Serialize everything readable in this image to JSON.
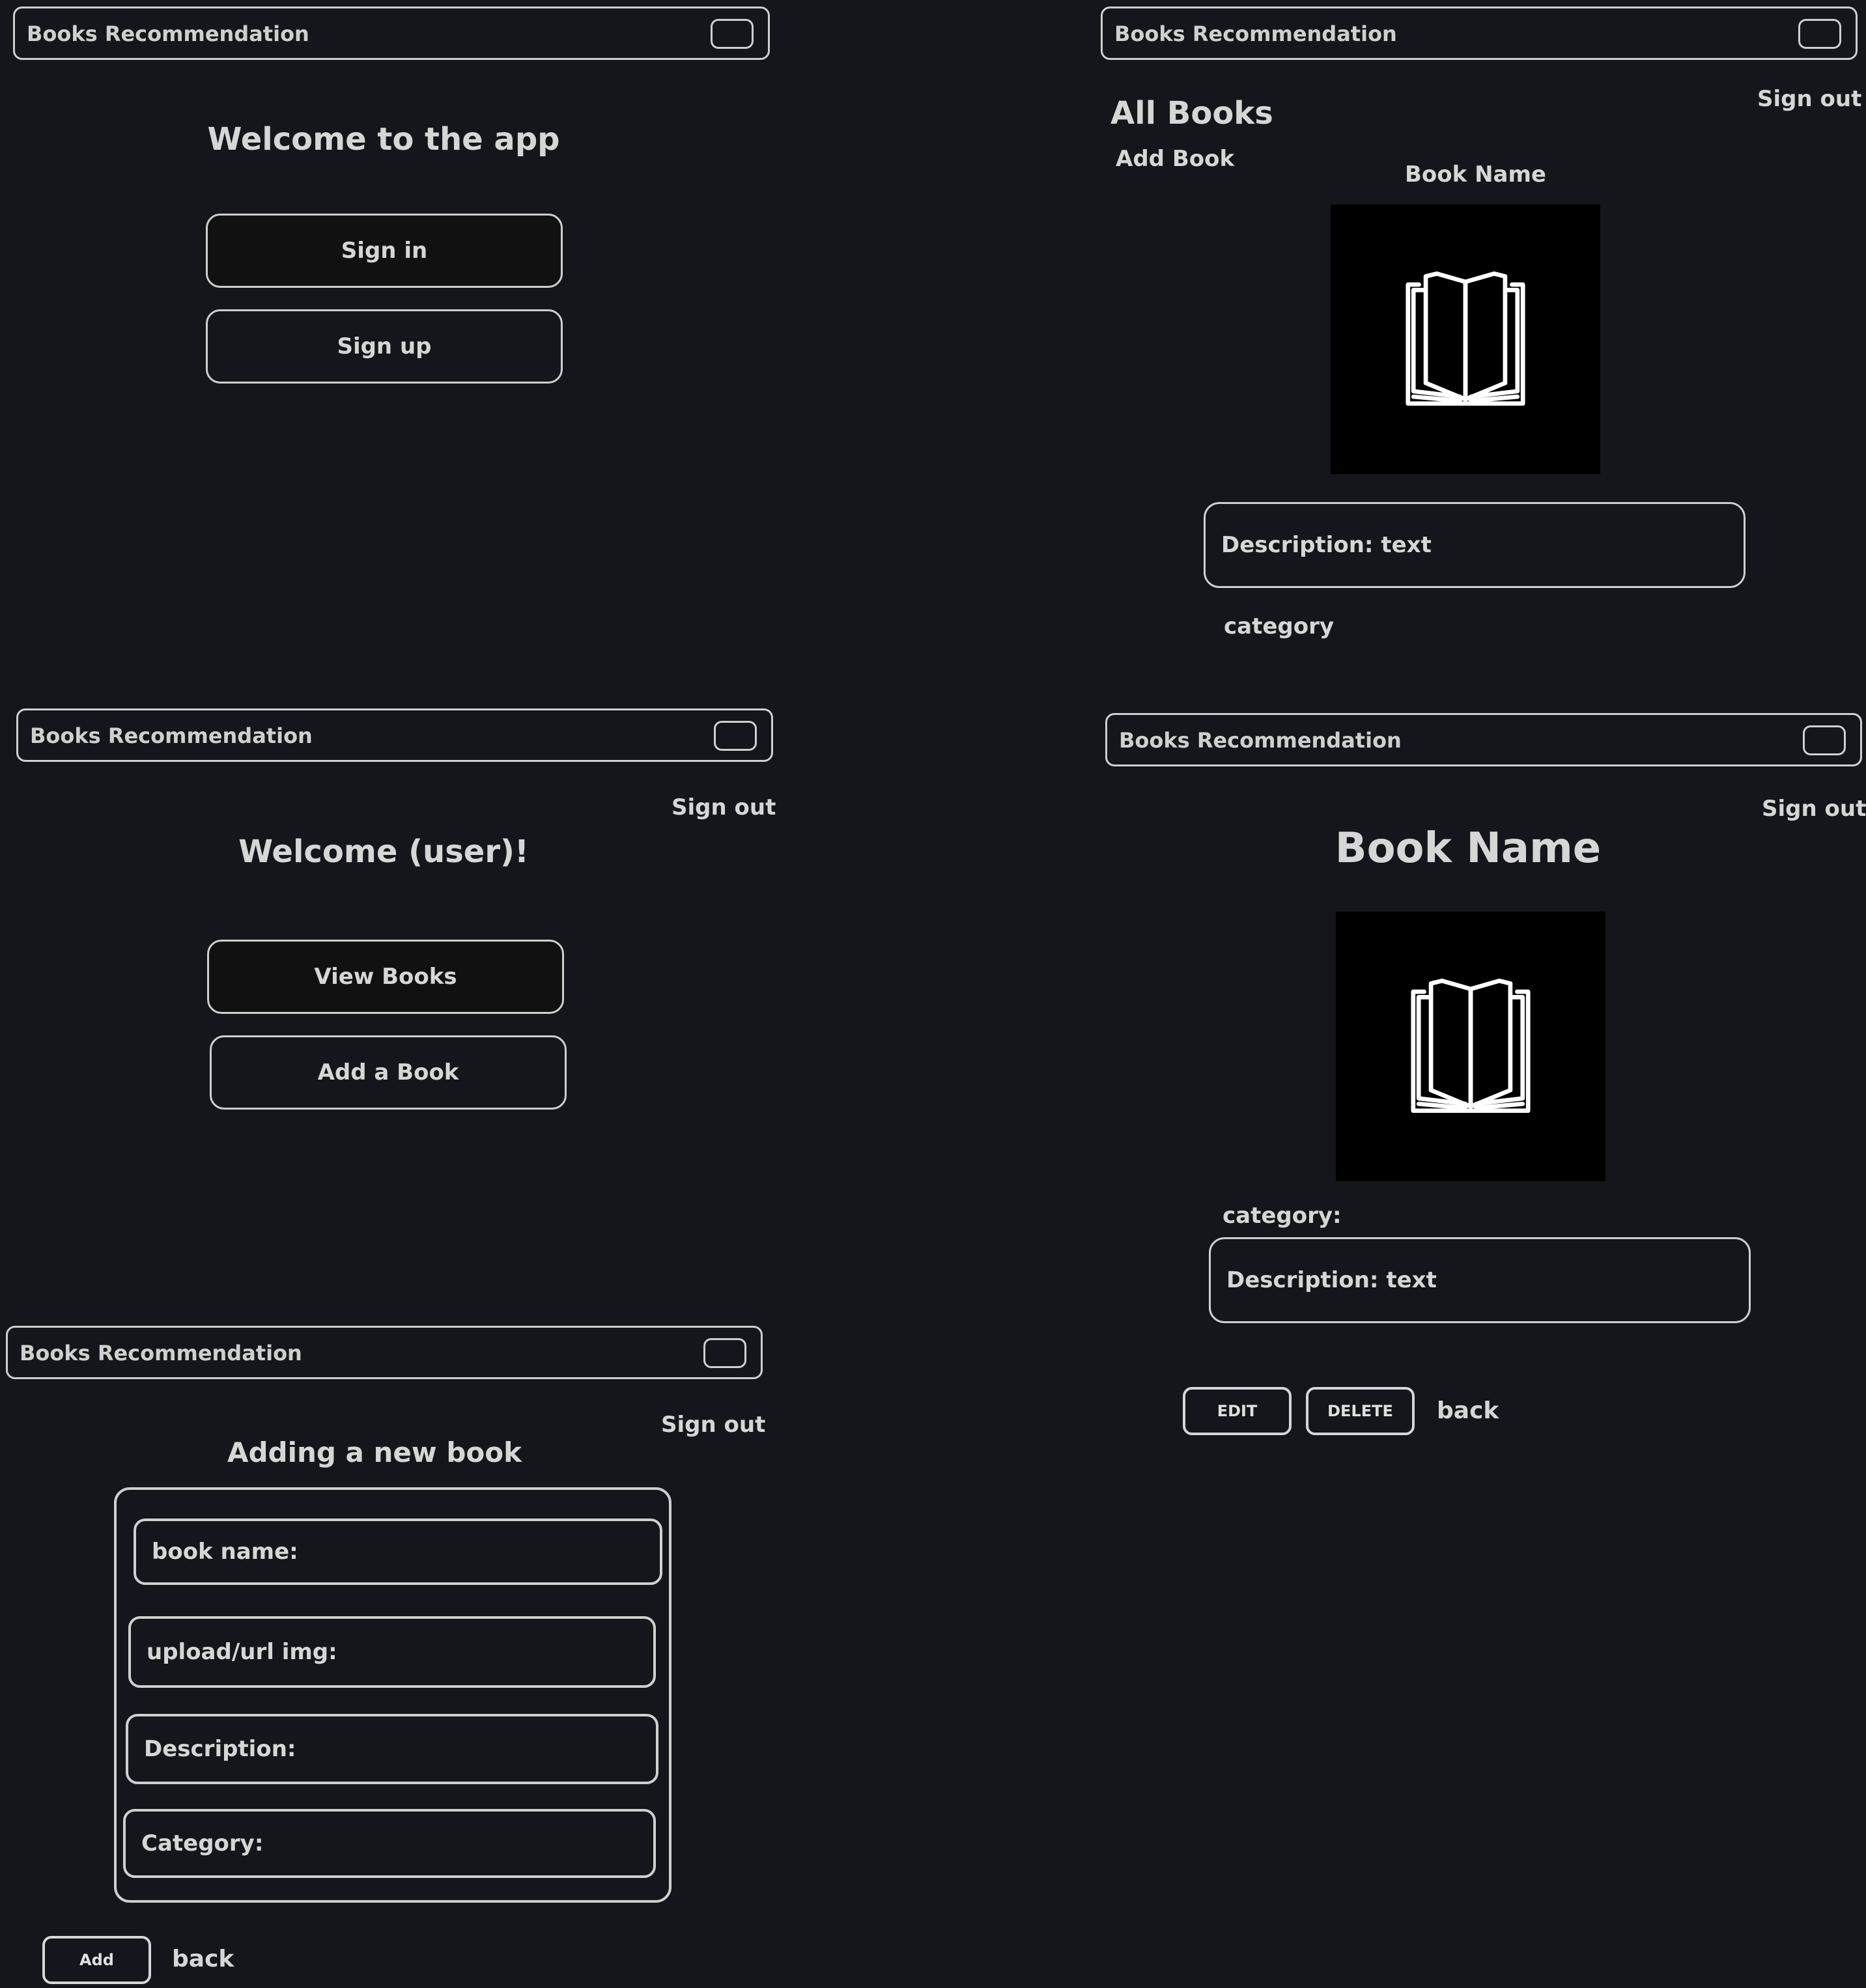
{
  "app_title": "Books Recommendation",
  "welcome_screen": {
    "title": "Welcome to the app",
    "sign_in": "Sign in",
    "sign_up": "Sign up"
  },
  "home_screen": {
    "sign_out": "Sign out",
    "title": "Welcome (user)!",
    "view_books": "View Books",
    "add_book": "Add a Book"
  },
  "add_screen": {
    "sign_out": "Sign out",
    "title": "Adding a new book",
    "fields": [
      "book name:",
      "upload/url img:",
      "Description:",
      "Category:"
    ],
    "add": "Add",
    "back": "back"
  },
  "all_books_screen": {
    "sign_out": "Sign out",
    "title": "All Books",
    "add_book": "Add Book",
    "book_name": "Book Name",
    "description": "Description: text",
    "category": "category"
  },
  "book_detail_screen": {
    "sign_out": "Sign out",
    "title": "Book Name",
    "category": "category:",
    "description": "Description: text",
    "edit": "EDIT",
    "delete": "DELETE",
    "back": "back"
  },
  "colors": {
    "background": "#14161b",
    "outline": "#cfcfcf",
    "image_bg": "#000000"
  },
  "icons": [
    "menu-icon",
    "open-book-icon"
  ]
}
